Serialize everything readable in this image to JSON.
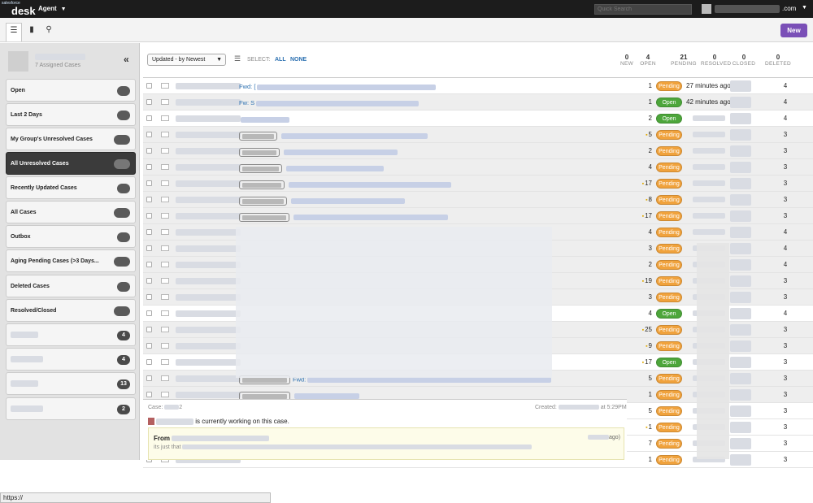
{
  "topbar": {
    "logo_small": "salesforce",
    "logo_text": "desk",
    "agent_menu": "Agent",
    "quick_search_placeholder": "Quick Search",
    "user_email_suffix": ".com"
  },
  "toolbar": {
    "new_label": "New"
  },
  "sidebar": {
    "profile": {
      "assigned": "7 Assigned Cases"
    },
    "filters": [
      {
        "label": "Open",
        "badge": ""
      },
      {
        "label": "Last 2 Days",
        "badge": ""
      },
      {
        "label": "My Group's Unresolved Cases",
        "badge": ""
      },
      {
        "label": "All Unresolved Cases",
        "badge": "",
        "selected": true
      },
      {
        "label": "Recently Updated Cases",
        "badge": ""
      },
      {
        "label": "All Cases",
        "badge": ""
      },
      {
        "label": "Outbox",
        "badge": ""
      },
      {
        "label": "Aging Pending Cases (>3 Days...",
        "badge": ""
      },
      {
        "label": "Deleted Cases",
        "badge": ""
      },
      {
        "label": "Resolved/Closed",
        "badge": ""
      },
      {
        "label": "",
        "badge": "4"
      },
      {
        "label": "",
        "badge": "4"
      },
      {
        "label": "",
        "badge": "13"
      },
      {
        "label": "",
        "badge": "2"
      }
    ],
    "status_url": "https://"
  },
  "list_header": {
    "sort": "Updated - by Newest",
    "select_label": "SELECT:",
    "select_all": "ALL",
    "select_none": "NONE",
    "stats": [
      {
        "count": "0",
        "label": "NEW"
      },
      {
        "count": "4",
        "label": "OPEN"
      },
      {
        "count": "21",
        "label": "PENDING"
      },
      {
        "count": "0",
        "label": "RESOLVED"
      },
      {
        "count": "0",
        "label": "CLOSED"
      },
      {
        "count": "0",
        "label": "DELETED"
      }
    ]
  },
  "rows": [
    {
      "subject_prefix": "Fwd: [",
      "count": "1",
      "comment": false,
      "status": "Pending",
      "time": "27 minutes ago",
      "priority": "4"
    },
    {
      "subject_prefix": "Fw: S",
      "count": "1",
      "comment": false,
      "status": "Open",
      "time": "42 minutes ago",
      "priority": "4"
    },
    {
      "subject_prefix": "",
      "count": "2",
      "comment": false,
      "status": "Open",
      "time": "",
      "priority": "4"
    },
    {
      "subject_prefix": "",
      "count": "5",
      "comment": true,
      "status": "Pending",
      "time": "",
      "priority": "3"
    },
    {
      "subject_prefix": "",
      "count": "2",
      "comment": false,
      "status": "Pending",
      "time": "",
      "priority": "3"
    },
    {
      "subject_prefix": "",
      "count": "4",
      "comment": false,
      "status": "Pending",
      "time": "",
      "priority": "3"
    },
    {
      "subject_prefix": "",
      "count": "17",
      "comment": true,
      "status": "Pending",
      "time": "",
      "priority": "3"
    },
    {
      "subject_prefix": "",
      "count": "8",
      "comment": true,
      "status": "Pending",
      "time": "",
      "priority": "3"
    },
    {
      "subject_prefix": "",
      "count": "17",
      "comment": true,
      "status": "Pending",
      "time": "",
      "priority": "3"
    },
    {
      "subject_prefix": "",
      "count": "4",
      "comment": false,
      "status": "Pending",
      "time": "",
      "priority": "4"
    },
    {
      "subject_prefix": "",
      "count": "3",
      "comment": false,
      "status": "Pending",
      "time": "",
      "priority": "4"
    },
    {
      "subject_prefix": "",
      "count": "2",
      "comment": false,
      "status": "Pending",
      "time": "",
      "priority": "4"
    },
    {
      "subject_prefix": "",
      "count": "19",
      "comment": true,
      "status": "Pending",
      "time": "",
      "priority": "3"
    },
    {
      "subject_prefix": "",
      "count": "3",
      "comment": false,
      "status": "Pending",
      "time": "",
      "priority": "3"
    },
    {
      "subject_prefix": "",
      "count": "4",
      "comment": false,
      "status": "Open",
      "time": "",
      "priority": "4"
    },
    {
      "subject_prefix": "",
      "count": "25",
      "comment": true,
      "status": "Pending",
      "time": "",
      "priority": "3"
    },
    {
      "subject_prefix": "",
      "count": "9",
      "comment": true,
      "status": "Pending",
      "time": "",
      "priority": "3"
    },
    {
      "subject_prefix": "",
      "count": "17",
      "comment": true,
      "status": "Open",
      "time": "",
      "priority": "3"
    },
    {
      "subject_prefix": "Fwd:",
      "count": "5",
      "comment": false,
      "status": "Pending",
      "time": "",
      "priority": "3"
    },
    {
      "subject_prefix": "",
      "count": "1",
      "comment": false,
      "status": "Pending",
      "time": "",
      "priority": "3"
    },
    {
      "subject_prefix": "",
      "count": "5",
      "comment": false,
      "status": "Pending",
      "time": "",
      "priority": "3"
    },
    {
      "subject_prefix": "",
      "count": "1",
      "comment": true,
      "status": "Pending",
      "time": "",
      "priority": "3"
    },
    {
      "subject_prefix": "",
      "count": "7",
      "comment": false,
      "status": "Pending",
      "time": "",
      "priority": "3"
    },
    {
      "subject_prefix": "",
      "count": "1",
      "comment": false,
      "status": "Pending",
      "time": "",
      "priority": "3"
    }
  ],
  "detail": {
    "case_label": "Case:",
    "created_label": "Created:",
    "created_suffix": "at 5:29PM",
    "working_text": "is currently working on this case.",
    "from_label": "From",
    "ago": "ago)",
    "body_prefix": "its just that"
  },
  "colors": {
    "pending": "#f0a23c",
    "open": "#4da63b",
    "new_button": "#7a4fb7",
    "link": "#2a6fb0"
  }
}
